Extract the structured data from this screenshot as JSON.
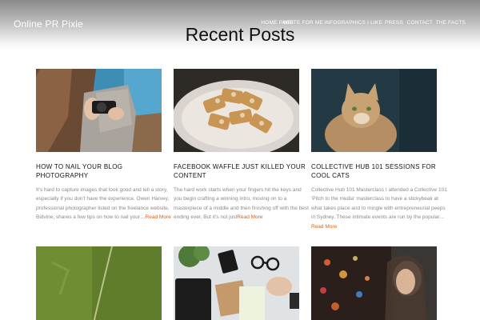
{
  "site": {
    "title": "Online PR Pixie"
  },
  "nav": {
    "items": [
      {
        "label": "HOME PAGE"
      },
      {
        "label": "WRITE FOR ME"
      },
      {
        "label": "INFOGRAPHICS I LIKE"
      },
      {
        "label": "PRESS"
      },
      {
        "label": "CONTACT"
      },
      {
        "label": "THE FACTS"
      }
    ]
  },
  "page": {
    "title": "Recent Posts"
  },
  "posts": [
    {
      "title": "HOW TO NAIL YOUR BLOG PHOTOGRAPHY",
      "excerpt": "It's hard to capture images that look good and tell a story, especially if you don't have the experience. Owen Harvey, professional photographer listed on the freelance website, Bidvine, shares a few tips on how to nail your…",
      "read_more": "Read More",
      "image": "photographer-holding-camera"
    },
    {
      "title": "FACEBOOK WAFFLE JUST KILLED YOUR CONTENT",
      "excerpt": "The hard work starts when your fingers hit the keys and you begin crafting a winning intro, moving on to a masterpiece of a middle and then finishing off with the best ending ever. But it's not just",
      "read_more": "Read More",
      "image": "waffles-with-powdered-sugar"
    },
    {
      "title": "COLLECTIVE HUB 101 SESSIONS FOR COOL CATS",
      "excerpt": "Collective Hub 101 Masterclass I attended a Collective 101 'Pitch to the media' masterclass to have a stickybeak at what takes place and to mingle with entrepreneurial peeps in Sydney. These intimate events are run by the popular…",
      "read_more": "Read More",
      "image": "fluffy-cat"
    },
    {
      "image": "aerial-green-field"
    },
    {
      "image": "desk-with-notebook-and-glasses"
    },
    {
      "image": "woman-with-city-lights"
    }
  ]
}
